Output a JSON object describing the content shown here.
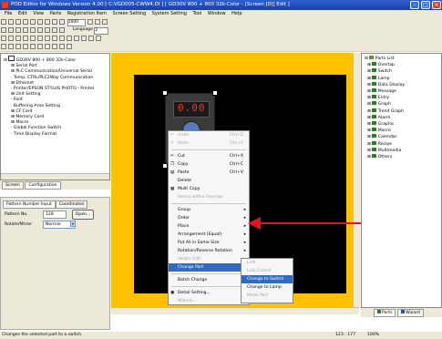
{
  "window": {
    "title": "POD Editor for Windows Version 4.00 [ C:VGD005-CWW4.DI ] [ GD30V 800 + 800 32k-Color - [Screen [0]] Edit ]"
  },
  "menubar": [
    "File",
    "Edit",
    "View",
    "Parts",
    "Registration Item",
    "Screen Setting",
    "System Setting",
    "Tool",
    "Window",
    "Help"
  ],
  "toolbar": {
    "zoom": "1000",
    "language_label": "Language",
    "language_value": "2"
  },
  "left_tree": {
    "root": "GD30V 800 + 800 32k-Color",
    "items": [
      "Serial Port",
      "PLC Communication/Universal Serial",
      "Temp. CTRL/PLC2Way Communication",
      "Ethernet",
      "Printer/EPSON STYLUS PHOTO - Printer",
      "Unit Setting",
      "Font",
      "Buffering Area Setting",
      "CF Card",
      "Memory Card",
      "Macro",
      "Global Function Switch",
      "Time Display Format"
    ]
  },
  "left_tabs": {
    "screen": "Screen",
    "configuration": "Configuration"
  },
  "props": {
    "tab1": "Pattern Number Input",
    "tab2": "Coordinates",
    "pattern_label": "Pattern No.",
    "pattern_value": "128",
    "open_button": "Open...",
    "rotate_label": "Rotate/Mirror",
    "rotate_value": "Normal"
  },
  "device": {
    "display": "0.00"
  },
  "context_menu": [
    {
      "label": "Undo",
      "key": "Ctrl+Z",
      "disabled": true
    },
    {
      "label": "Redo",
      "key": "Ctrl+Y",
      "disabled": true
    },
    {
      "label": "Cut",
      "key": "Ctrl+X"
    },
    {
      "label": "Copy",
      "key": "Ctrl+C"
    },
    {
      "label": "Paste",
      "key": "Ctrl+V"
    },
    {
      "label": "Delete",
      "key": ""
    },
    {
      "label": "Multi Copy",
      "key": ""
    },
    {
      "label": "Select within Overlap",
      "key": "",
      "disabled": true
    },
    {
      "label": "Group",
      "sub": true
    },
    {
      "label": "Order",
      "sub": true
    },
    {
      "label": "Place",
      "sub": true
    },
    {
      "label": "Arrangement (Equal)",
      "sub": true
    },
    {
      "label": "Put All in Same Size",
      "sub": true
    },
    {
      "label": "Rotation/Reverse Rotation",
      "sub": true
    },
    {
      "label": "Vertex Edit",
      "disabled": true
    },
    {
      "label": "Change Part",
      "sub": true,
      "highlight": true
    },
    {
      "label": "Batch Change"
    },
    {
      "label": "Detail Setting..."
    },
    {
      "label": "Wizard...",
      "disabled": true
    }
  ],
  "submenu": [
    {
      "label": "Link",
      "disabled": true
    },
    {
      "label": "Link Cancel",
      "disabled": true
    },
    {
      "label": "Change to Switch",
      "highlight": true
    },
    {
      "label": "Change to Lamp"
    },
    {
      "label": "Mode Part",
      "disabled": true
    }
  ],
  "right_tree": [
    "Parts List",
    "Overlap",
    "Switch",
    "Lamp",
    "Data Display",
    "Message",
    "Entry",
    "Graph",
    "Trend Graph",
    "Alarm",
    "Graphic",
    "Macro",
    "Calendar",
    "Recipe",
    "Multimedia",
    "Others"
  ],
  "right_tabs": {
    "parts": "Parts",
    "wizard": "Wizard"
  },
  "status": {
    "text": "Changes the selected part to a switch.",
    "coords": "123 : 177",
    "zoom": "100%"
  },
  "colors": {
    "work_bg": "#ffc000",
    "screen_bg": "#000000",
    "title_bg": "#2f5fd0",
    "menu_highlight": "#316ac5",
    "arrow": "#e0141e"
  }
}
